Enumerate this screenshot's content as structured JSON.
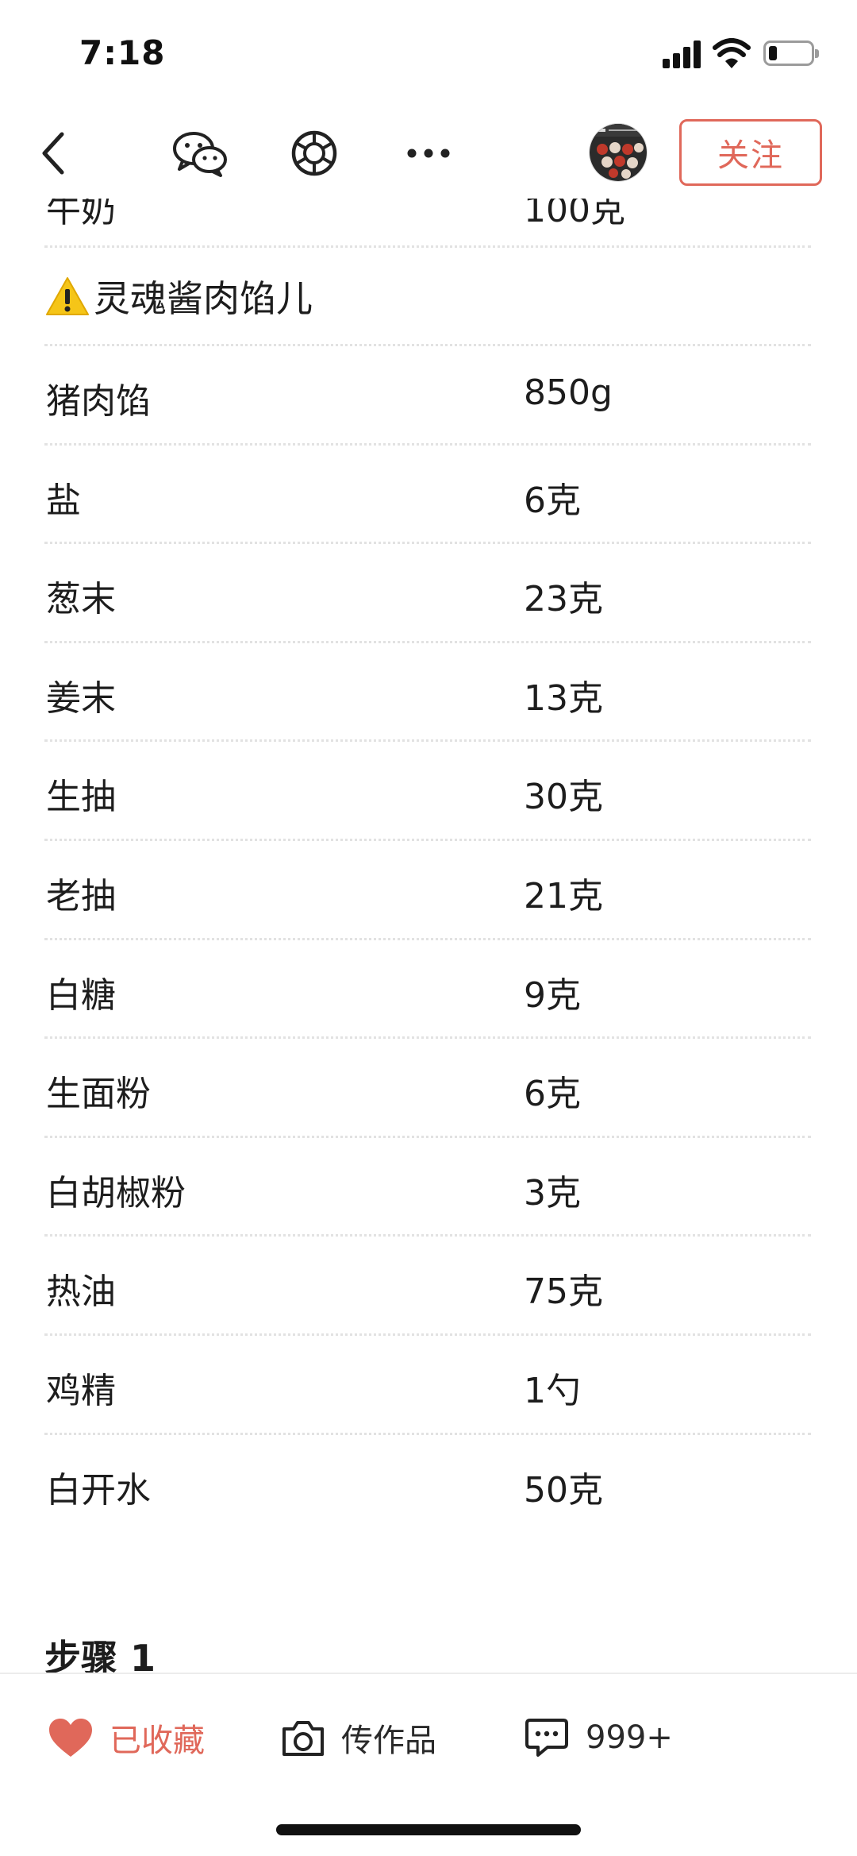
{
  "status_bar": {
    "time": "7:18",
    "battery_level": 0.2
  },
  "nav": {
    "back_icon": "chevron-left-icon",
    "share_icons": [
      "wechat-icon",
      "moments-icon",
      "more-icon"
    ],
    "follow_label": "关注"
  },
  "partial_row": {
    "name": "牛奶",
    "amount": "100克"
  },
  "section": {
    "icon": "warning-icon",
    "title": "灵魂酱肉馅儿"
  },
  "ingredients": [
    {
      "name": "猪肉馅",
      "amount": "850g"
    },
    {
      "name": "盐",
      "amount": "6克"
    },
    {
      "name": "葱末",
      "amount": "23克"
    },
    {
      "name": "姜末",
      "amount": "13克"
    },
    {
      "name": "生抽",
      "amount": "30克"
    },
    {
      "name": "老抽",
      "amount": "21克"
    },
    {
      "name": "白糖",
      "amount": "9克"
    },
    {
      "name": "生面粉",
      "amount": "6克"
    },
    {
      "name": "白胡椒粉",
      "amount": "3克"
    },
    {
      "name": "热油",
      "amount": "75克"
    },
    {
      "name": "鸡精",
      "amount": "1勺"
    },
    {
      "name": "白开水",
      "amount": "50克"
    }
  ],
  "step": {
    "title": "步骤 1"
  },
  "bottom_bar": {
    "favorite_label": "已收藏",
    "upload_label": "传作品",
    "comment_count": "999+"
  },
  "colors": {
    "accent": "#e0685a",
    "text": "#1d1d1d",
    "divider": "#e2e2e2"
  }
}
